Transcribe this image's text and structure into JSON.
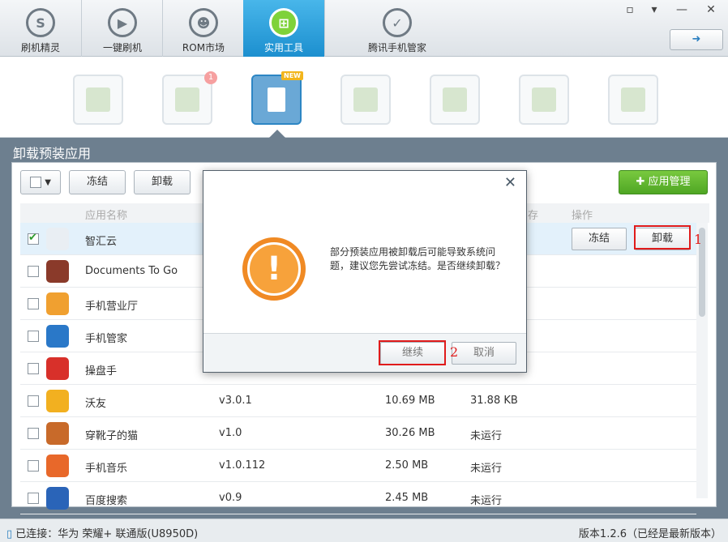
{
  "nav": [
    {
      "label": "刷机精灵",
      "icon": "S"
    },
    {
      "label": "一键刷机",
      "icon": "▶"
    },
    {
      "label": "ROM市场",
      "icon": "☻"
    },
    {
      "label": "实用工具",
      "icon": "⊞"
    },
    {
      "label": "腾讯手机管家",
      "icon": "✓"
    }
  ],
  "window_controls": [
    "▫",
    "▾",
    "—",
    "✕"
  ],
  "back_icon": "➜",
  "tools": {
    "badge_count": "1",
    "new_badge": "NEW"
  },
  "section_title": "卸载预装应用",
  "toolbar": {
    "freeze": "冻结",
    "uninstall": "卸载",
    "app_manage": "应用管理"
  },
  "table_headers": {
    "name": "应用名称",
    "storage": "存",
    "action": "操作"
  },
  "rows": [
    {
      "name": "智汇云",
      "version": "",
      "size": "",
      "mem": "",
      "checked": true,
      "color": "#e9eef3"
    },
    {
      "name": "Documents To Go",
      "version": "",
      "size": "",
      "mem": "",
      "checked": false,
      "color": "#8a3a2a"
    },
    {
      "name": "手机营业厅",
      "version": "",
      "size": "",
      "mem": "",
      "checked": false,
      "color": "#f0a030"
    },
    {
      "name": "手机管家",
      "version": "",
      "size": "",
      "mem": "",
      "checked": false,
      "color": "#2a78c8"
    },
    {
      "name": "操盘手",
      "version": "",
      "size": "",
      "mem": "",
      "checked": false,
      "color": "#d8302a"
    },
    {
      "name": "沃友",
      "version": "v3.0.1",
      "size": "10.69 MB",
      "mem": "31.88 KB",
      "checked": false,
      "color": "#f2b020"
    },
    {
      "name": "穿靴子的猫",
      "version": "v1.0",
      "size": "30.26 MB",
      "mem": "未运行",
      "checked": false,
      "color": "#c86a2a"
    },
    {
      "name": "手机音乐",
      "version": "v1.0.112",
      "size": "2.50 MB",
      "mem": "未运行",
      "checked": false,
      "color": "#e8682a"
    },
    {
      "name": "百度搜索",
      "version": "v0.9",
      "size": "2.45 MB",
      "mem": "未运行",
      "checked": false,
      "color": "#2a64b8"
    }
  ],
  "row_actions": {
    "freeze": "冻结",
    "uninstall": "卸载"
  },
  "annotations": {
    "one": "1",
    "two": "2"
  },
  "dialog": {
    "close": "✕",
    "message": "部分预装应用被卸载后可能导致系统问题，建议您先尝试冻结。是否继续卸载？",
    "continue": "继续",
    "cancel": "取消"
  },
  "status": {
    "connected": "已连接：华为 荣耀+ 联通版(U8950D)",
    "version": "版本1.2.6（已经是最新版本）"
  }
}
